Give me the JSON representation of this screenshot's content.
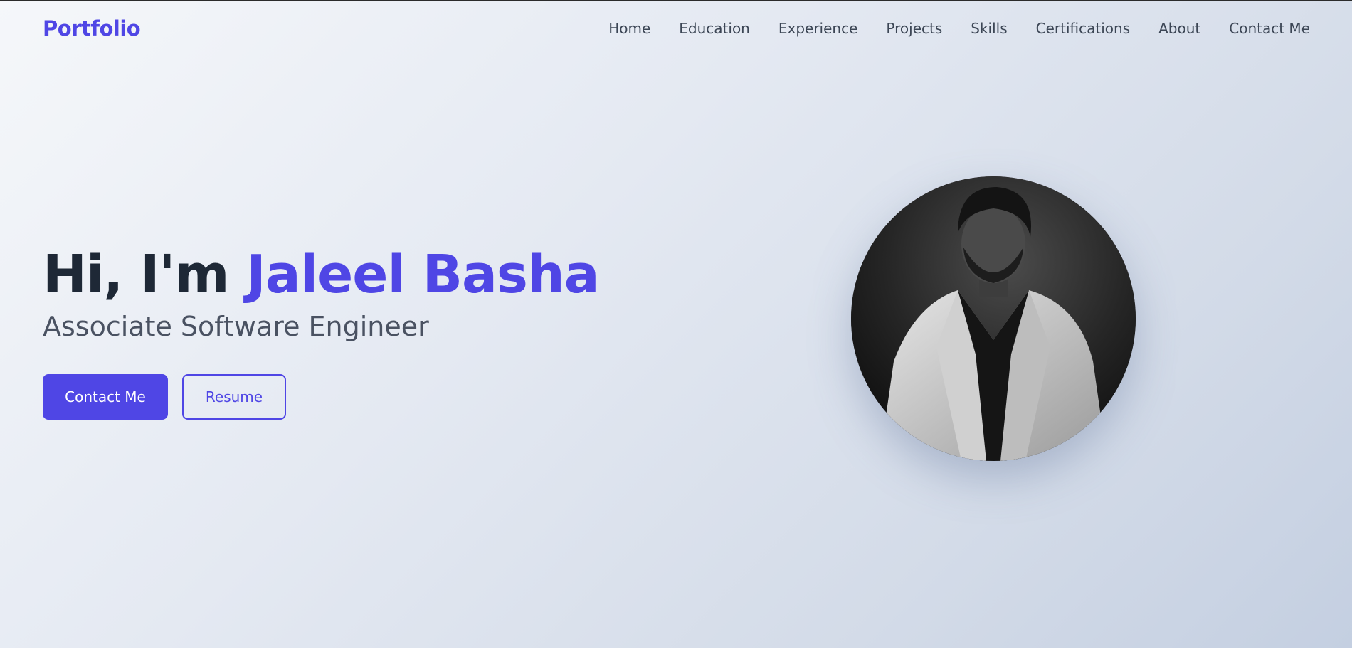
{
  "nav": {
    "logo": "Portfolio",
    "links": [
      "Home",
      "Education",
      "Experience",
      "Projects",
      "Skills",
      "Certifications",
      "About",
      "Contact Me"
    ]
  },
  "hero": {
    "greeting": "Hi, I'm",
    "name": "Jaleel Basha",
    "title": "Associate Software Engineer",
    "primary_button": "Contact Me",
    "secondary_button": "Resume"
  },
  "colors": {
    "accent": "#4f46e5",
    "heading": "#1e2836",
    "body_text": "#4a5262"
  },
  "avatar": {
    "icon": "profile-photo"
  }
}
